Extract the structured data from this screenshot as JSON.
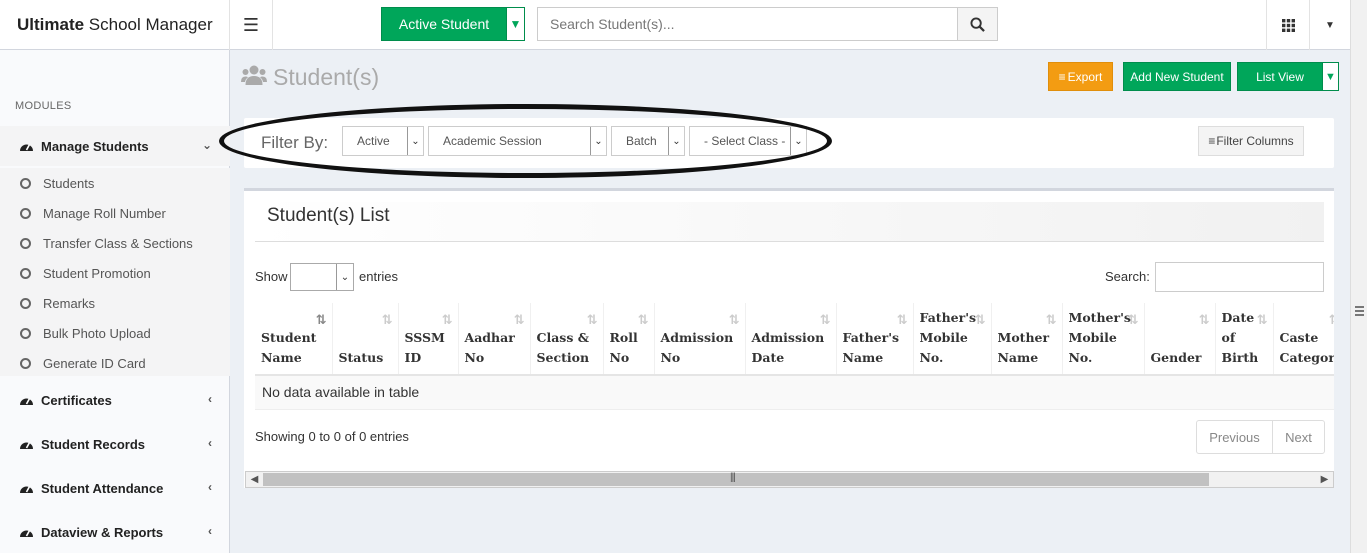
{
  "brand": {
    "bold": "Ultimate",
    "rest": " School Manager"
  },
  "header": {
    "active_student_label": "Active Student",
    "search_placeholder": "Search Student(s)..."
  },
  "sidebar": {
    "section_label": "MODULES",
    "manage_students": "Manage Students",
    "sub_items": [
      "Students",
      "Manage Roll Number",
      "Transfer Class & Sections",
      "Student Promotion",
      "Remarks",
      "Bulk Photo Upload",
      "Generate ID Card"
    ],
    "certificates": "Certificates",
    "student_records": "Student Records",
    "student_attendance": "Student Attendance",
    "dataview_reports": "Dataview & Reports"
  },
  "page": {
    "title": "Student(s)",
    "export_label": "Export",
    "add_new_label": "Add New Student",
    "list_view_label": "List View"
  },
  "filter": {
    "label": "Filter By:",
    "status": "Active",
    "session": "Academic Session",
    "batch": "Batch",
    "class": "- Select Class -",
    "filter_columns_label": "Filter Columns"
  },
  "list": {
    "title": "Student(s) List",
    "show_label": "Show",
    "entries_label": "entries",
    "search_label": "Search:",
    "columns": [
      "Student Name",
      "Status",
      "SSSM ID",
      "Aadhar No",
      "Class & Section",
      "Roll No",
      "Admission No",
      "Admission Date",
      "Father's Name",
      "Father's Mobile No.",
      "Mother Name",
      "Mother's Mobile No.",
      "Gender",
      "Date of Birth",
      "Caste Category"
    ],
    "empty_message": "No data available in table",
    "info": "Showing 0 to 0 of 0 entries",
    "prev_label": "Previous",
    "next_label": "Next"
  },
  "colors": {
    "green": "#00a65a",
    "orange": "#f39c12",
    "background": "#ecf0f5"
  }
}
